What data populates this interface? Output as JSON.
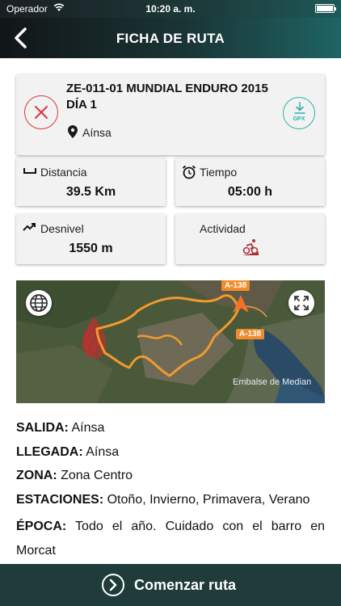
{
  "status_bar": {
    "carrier": "Operador",
    "time": "10:20 a. m."
  },
  "nav": {
    "title": "FICHA DE RUTA",
    "back_icon": "chevron-left-icon"
  },
  "route": {
    "title": "ZE-011-01 MUNDIAL ENDURO 2015 DÍA 1",
    "place": "Aínsa",
    "gpx_label": "GPX"
  },
  "stats": {
    "distance": {
      "label": "Distancia",
      "value": "39.5 Km"
    },
    "time": {
      "label": "Tiempo",
      "value": "05:00 h"
    },
    "elevation": {
      "label": "Desnivel",
      "value": "1550 m"
    },
    "activity": {
      "label": "Actividad",
      "icon": "mountain-bike-icon"
    }
  },
  "map": {
    "road_1": "A-138",
    "road_2": "A-138",
    "lake": "Embalse de Median"
  },
  "info": {
    "salida_label": "SALIDA:",
    "salida": "Aínsa",
    "llegada_label": "LLEGADA:",
    "llegada": "Aínsa",
    "zona_label": "ZONA:",
    "zona": "Zona Centro",
    "estaciones_label": "ESTACIONES:",
    "estaciones": "Otoño, Invierno, Primavera, Verano",
    "epoca_label": "ÉPOCA:",
    "epoca": "Todo el año. Cuidado con el barro en Morcat"
  },
  "bottom": {
    "start_label": "Comenzar ruta"
  },
  "colors": {
    "accent": "#2ab3a6",
    "danger": "#d9363e",
    "route_orange": "#f29a2e",
    "route_red": "#d8262b",
    "bar": "#1f3b3a"
  }
}
